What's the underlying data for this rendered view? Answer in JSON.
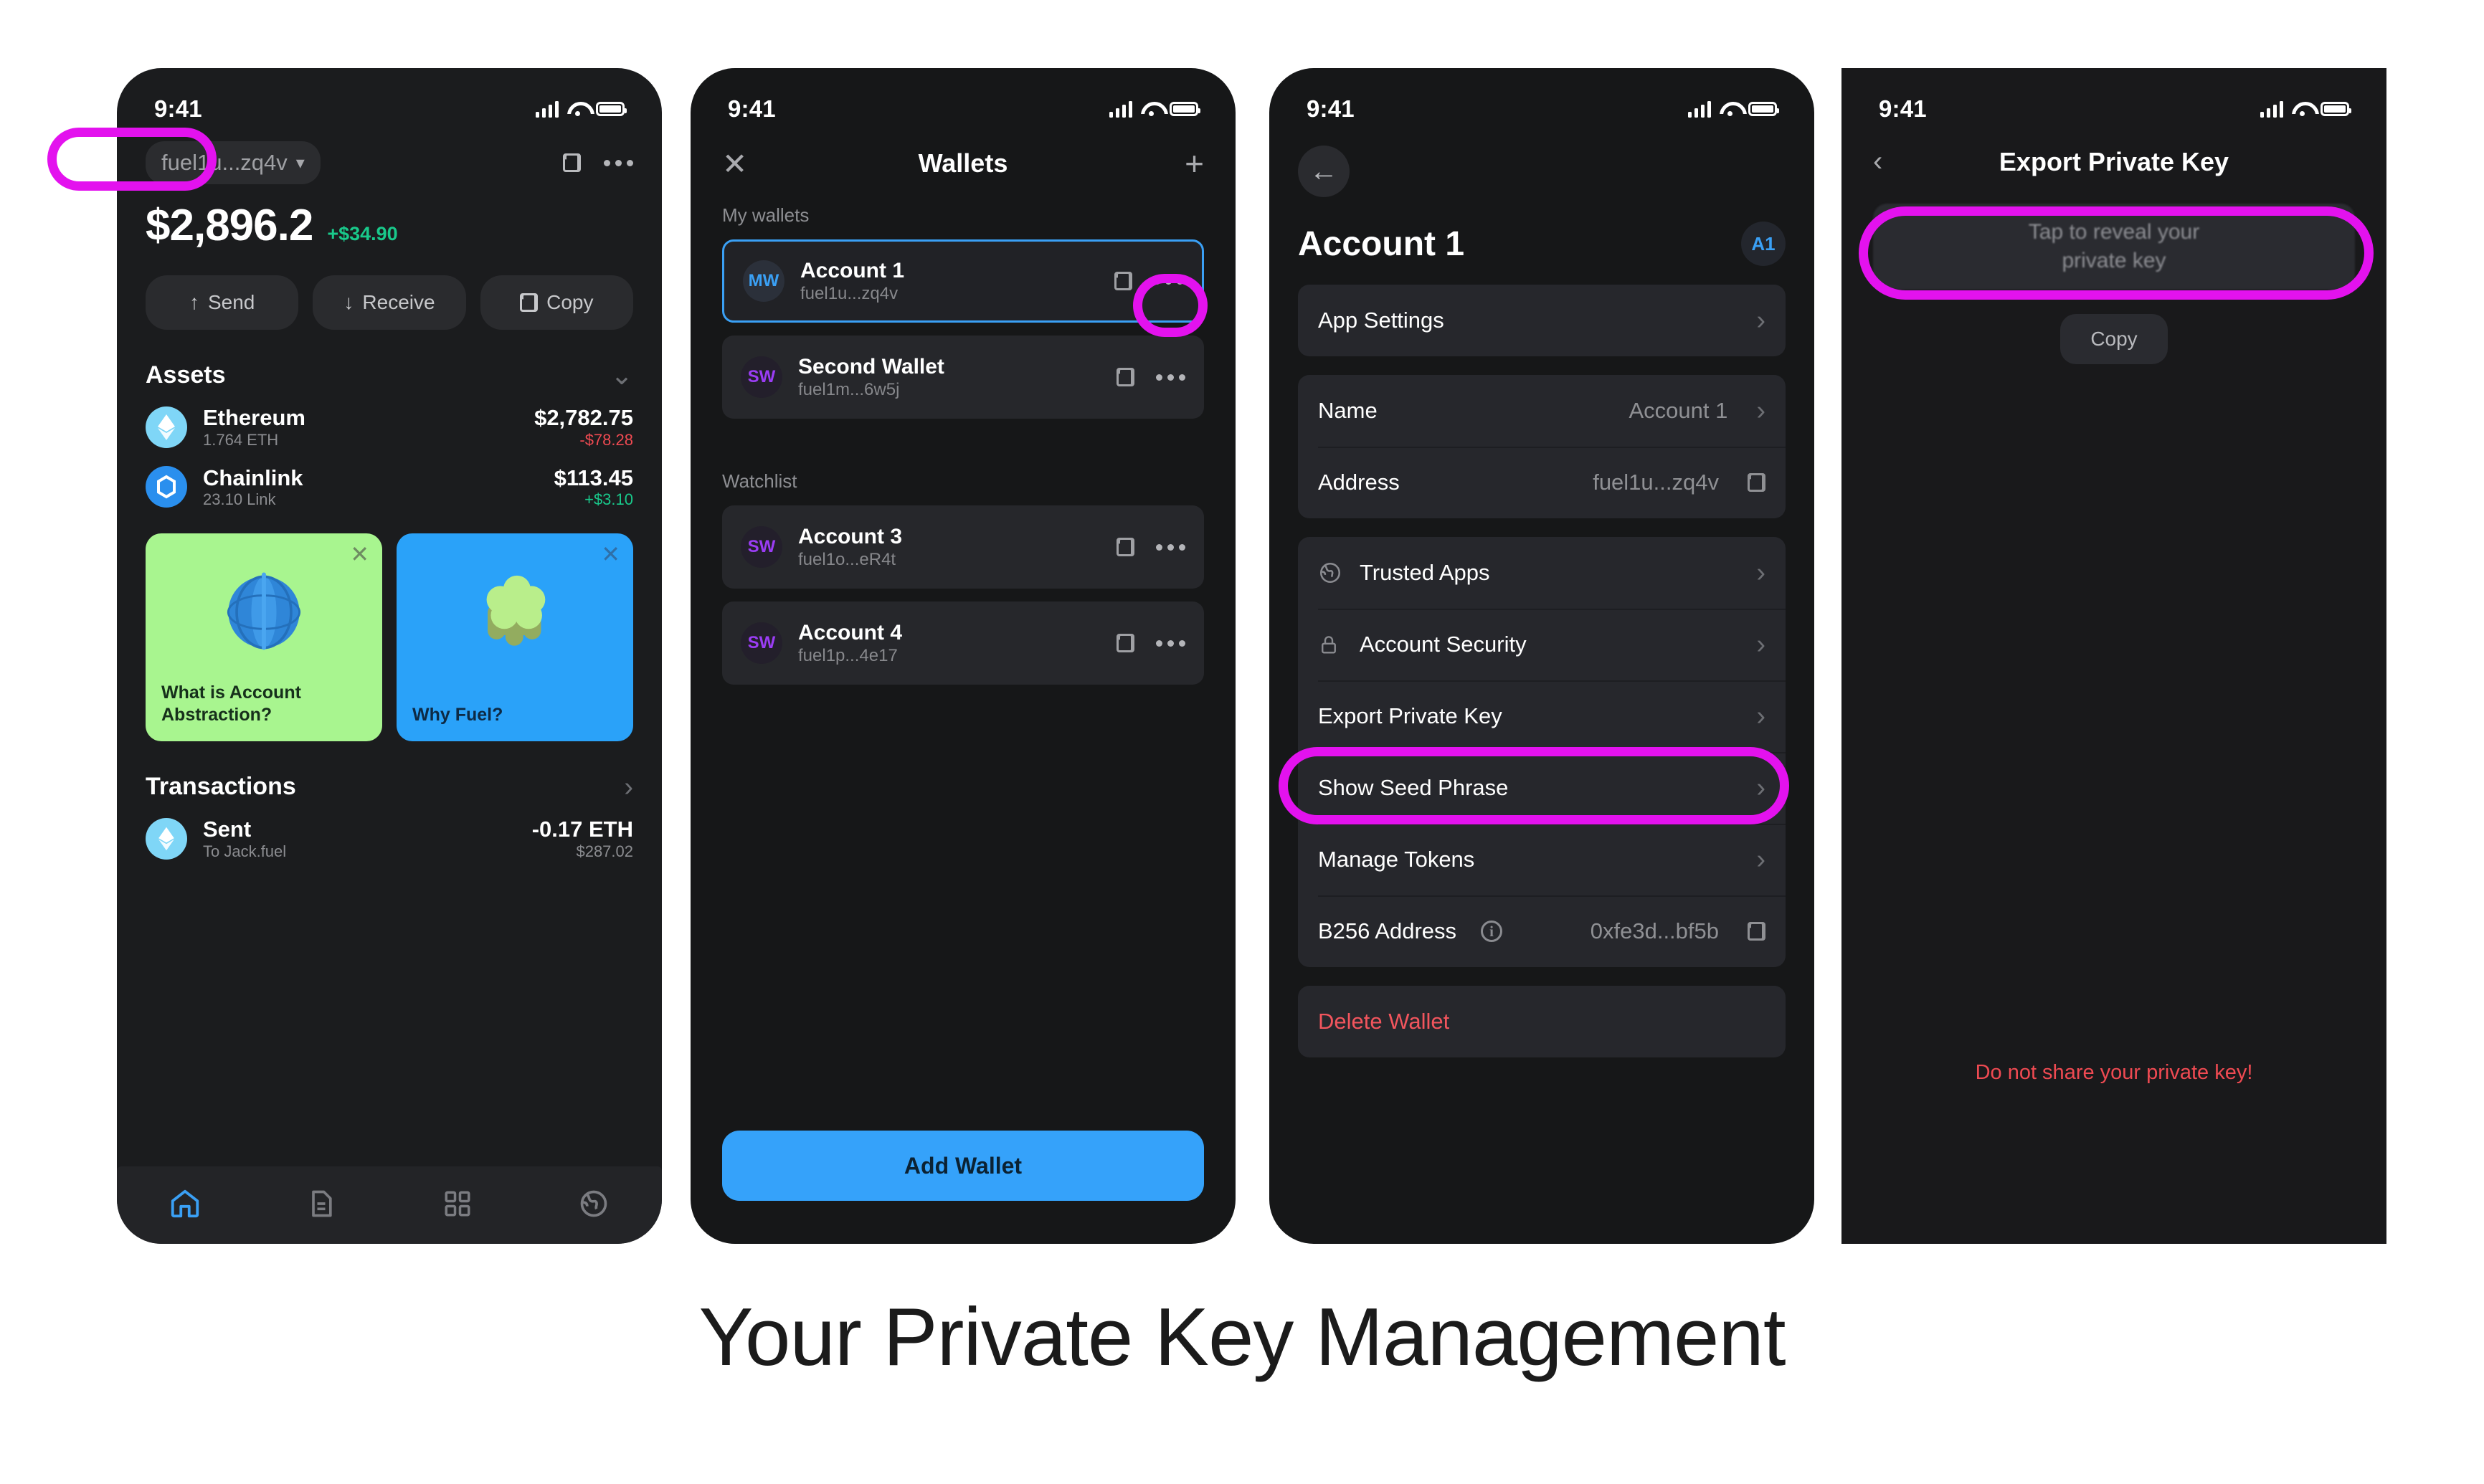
{
  "caption": "Your Private Key Management",
  "colors": {
    "highlight": "#e312ee",
    "accent_blue": "#35a2fa",
    "positive_green": "#19c98b",
    "negative_red": "#ef4a52",
    "danger_red": "#f2555d",
    "card_green": "#a8f58f",
    "card_blue": "#2aa2f9"
  },
  "status_bar": {
    "time": "9:41"
  },
  "phone1": {
    "address_pill": "fuel1u...zq4v",
    "balance": "$2,896.2",
    "balance_change": "+$34.90",
    "actions": [
      {
        "label": "Send",
        "icon": "arrow-up-icon"
      },
      {
        "label": "Receive",
        "icon": "arrow-down-icon"
      },
      {
        "label": "Copy",
        "icon": "copy-icon"
      }
    ],
    "assets_header": "Assets",
    "assets": [
      {
        "name": "Ethereum",
        "amount": "1.764 ETH",
        "value": "$2,782.75",
        "change": "-$78.28",
        "change_dir": "down"
      },
      {
        "name": "Chainlink",
        "amount": "23.10 Link",
        "value": "$113.45",
        "change": "+$3.10",
        "change_dir": "up"
      }
    ],
    "promo_cards": [
      {
        "title": "What is Account Abstraction?",
        "theme": "green"
      },
      {
        "title": "Why Fuel?",
        "theme": "blue"
      }
    ],
    "transactions_header": "Transactions",
    "transactions": [
      {
        "title": "Sent",
        "subtitle": "To Jack.fuel",
        "amount": "-0.17 ETH",
        "fiat": "$287.02"
      }
    ],
    "tabs": [
      {
        "icon": "home-icon",
        "active": true
      },
      {
        "icon": "document-icon",
        "active": false
      },
      {
        "icon": "grid-icon",
        "active": false
      },
      {
        "icon": "globe-icon",
        "active": false
      }
    ]
  },
  "phone2": {
    "title": "Wallets",
    "close_icon": "close-icon",
    "add_icon": "plus-icon",
    "my_wallets_label": "My wallets",
    "watchlist_label": "Watchlist",
    "my_wallets": [
      {
        "initials": "MW",
        "name": "Account 1",
        "address": "fuel1u...zq4v",
        "selected": true
      },
      {
        "initials": "SW",
        "name": "Second Wallet",
        "address": "fuel1m...6w5j",
        "selected": false
      }
    ],
    "watchlist": [
      {
        "initials": "SW",
        "name": "Account 3",
        "address": "fuel1o...eR4t",
        "selected": false
      },
      {
        "initials": "SW",
        "name": "Account 4",
        "address": "fuel1p...4e17",
        "selected": false
      }
    ],
    "add_wallet_label": "Add Wallet"
  },
  "phone3": {
    "back_icon": "arrow-left-icon",
    "title": "Account 1",
    "badge": "A1",
    "group1": [
      {
        "label": "App Settings",
        "value": "",
        "trailing": "chevron"
      }
    ],
    "group2": [
      {
        "label": "Name",
        "value": "Account 1",
        "trailing": "chevron"
      },
      {
        "label": "Address",
        "value": "fuel1u...zq4v",
        "trailing": "copy"
      }
    ],
    "group3": [
      {
        "label": "Trusted Apps",
        "value": "",
        "trailing": "chevron",
        "icon": "globe-icon"
      },
      {
        "label": "Account Security",
        "value": "",
        "trailing": "chevron",
        "icon": "lock-icon"
      },
      {
        "label": "Export Private Key",
        "value": "",
        "trailing": "chevron",
        "icon": ""
      },
      {
        "label": "Show Seed Phrase",
        "value": "",
        "trailing": "chevron",
        "icon": ""
      },
      {
        "label": "Manage Tokens",
        "value": "",
        "trailing": "chevron",
        "icon": ""
      },
      {
        "label": "B256 Address",
        "value": "0xfe3d...bf5b",
        "trailing": "copy",
        "icon": "",
        "info": "info-icon"
      }
    ],
    "group4": [
      {
        "label": "Delete Wallet",
        "value": "",
        "trailing": "",
        "danger": true
      }
    ]
  },
  "phone4": {
    "back_icon": "chevron-left-icon",
    "title": "Export Private Key",
    "reveal_line1": "Tap to reveal your",
    "reveal_line2": "private key",
    "copy_label": "Copy",
    "warning": "Do not share your private key!"
  }
}
